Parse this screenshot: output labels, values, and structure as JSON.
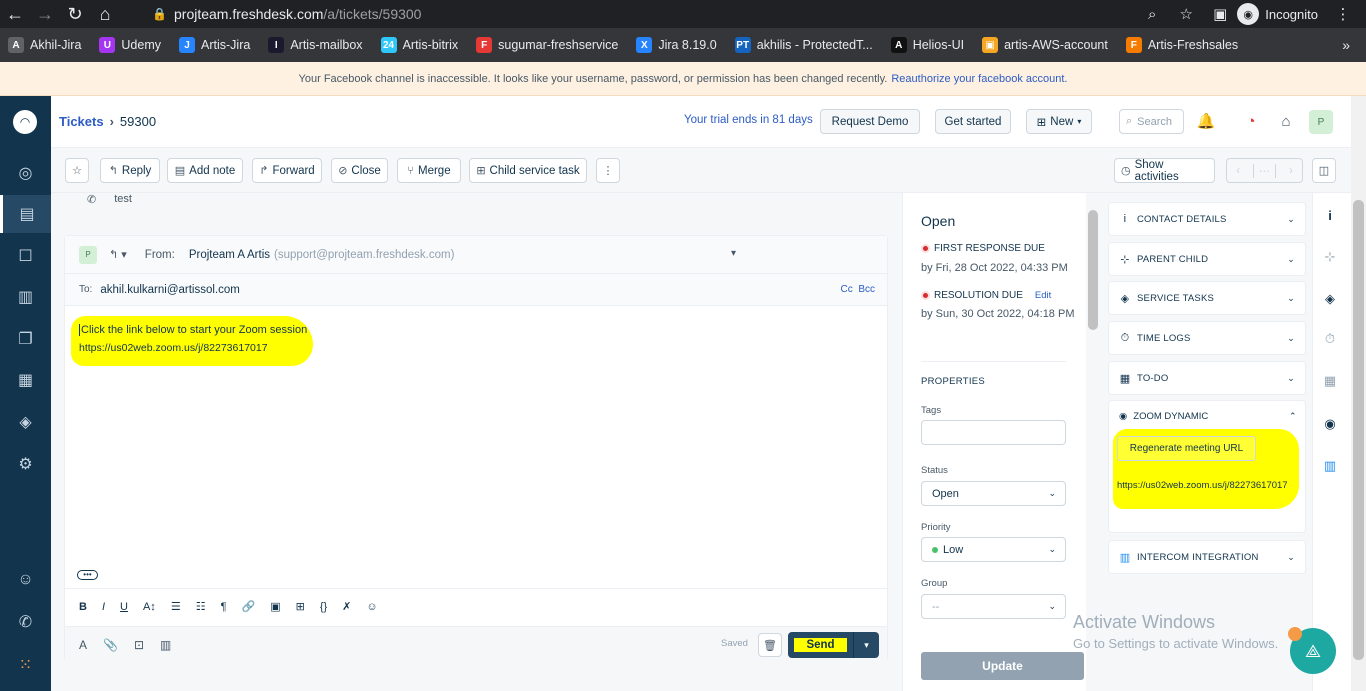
{
  "browser": {
    "url_host": "projteam.freshdesk.com",
    "url_path": "/a/tickets/59300",
    "incognito_label": "Incognito",
    "bookmarks": [
      {
        "label": "Akhil-Jira",
        "color": "#5f6368",
        "glyph": "A"
      },
      {
        "label": "Udemy",
        "color": "#a435f0",
        "glyph": "U"
      },
      {
        "label": "Artis-Jira",
        "color": "#2684ff",
        "glyph": "J"
      },
      {
        "label": "Artis-mailbox",
        "color": "#1a1a2e",
        "glyph": "I"
      },
      {
        "label": "Artis-bitrix",
        "color": "#2fc7f7",
        "glyph": "24"
      },
      {
        "label": "sugumar-freshservice",
        "color": "#e53935",
        "glyph": "F"
      },
      {
        "label": "Jira 8.19.0",
        "color": "#2684ff",
        "glyph": "X"
      },
      {
        "label": "akhilis - ProtectedT...",
        "color": "#1565c0",
        "glyph": "PT"
      },
      {
        "label": "Helios-UI",
        "color": "#111111",
        "glyph": "A"
      },
      {
        "label": "artis-AWS-account",
        "color": "#f5a623",
        "glyph": "▣"
      },
      {
        "label": "Artis-Freshsales",
        "color": "#f57c00",
        "glyph": "F"
      }
    ]
  },
  "banner": {
    "text": "Your Facebook channel is inaccessible. It looks like your username, password, or permission has been changed recently.",
    "link": "Reauthorize your facebook account."
  },
  "header": {
    "crumb_root": "Tickets",
    "crumb_sep": "›",
    "ticket_id": "59300",
    "trial": "Your trial ends in 81 days",
    "request_demo": "Request Demo",
    "get_started": "Get started",
    "new_label": "New",
    "search_placeholder": "Search",
    "avatar": "P"
  },
  "toolbar": {
    "reply": "Reply",
    "add_note": "Add note",
    "forward": "Forward",
    "close": "Close",
    "merge": "Merge",
    "child_task": "Child service task",
    "show_activities": "Show activities"
  },
  "conversation": {
    "prev_text": "test"
  },
  "editor": {
    "avatar": "P",
    "from_label": "From:",
    "from_name": "Projteam A Artis",
    "from_email": "(support@projteam.freshdesk.com)",
    "to_label": "To:",
    "to_value": "akhil.kulkarni@artissol.com",
    "cc": "Cc",
    "bcc": "Bcc",
    "body_line1": "Click the link below to start your Zoom session",
    "body_line2": "https://us02web.zoom.us/j/82273617017",
    "saved": "Saved",
    "send": "Send"
  },
  "properties": {
    "status_title": "Open",
    "first_response_label": "FIRST RESPONSE DUE",
    "first_response_value": "by Fri, 28 Oct 2022, 04:33 PM",
    "resolution_label": "RESOLUTION DUE",
    "resolution_edit": "Edit",
    "resolution_value": "by Sun, 30 Oct 2022, 04:18 PM",
    "section": "PROPERTIES",
    "tags_label": "Tags",
    "status_label": "Status",
    "status_value": "Open",
    "priority_label": "Priority",
    "priority_value": "Low",
    "group_label": "Group",
    "group_value": "--",
    "update": "Update"
  },
  "apps": {
    "contact": "CONTACT DETAILS",
    "parent_child": "PARENT CHILD",
    "service_tasks": "SERVICE TASKS",
    "time_logs": "TIME LOGS",
    "todo": "TO-DO",
    "zoom": "ZOOM DYNAMIC",
    "regenerate": "Regenerate meeting URL",
    "zoom_url": "https://us02web.zoom.us/j/82273617017",
    "intercom": "INTERCOM INTEGRATION"
  },
  "watermark": {
    "line1": "Activate Windows",
    "line2": "Go to Settings to activate Windows."
  },
  "colors": {
    "sidebar": "#12344d",
    "link": "#2c5cc5",
    "highlight": "#ffff00",
    "send": "#264966"
  }
}
